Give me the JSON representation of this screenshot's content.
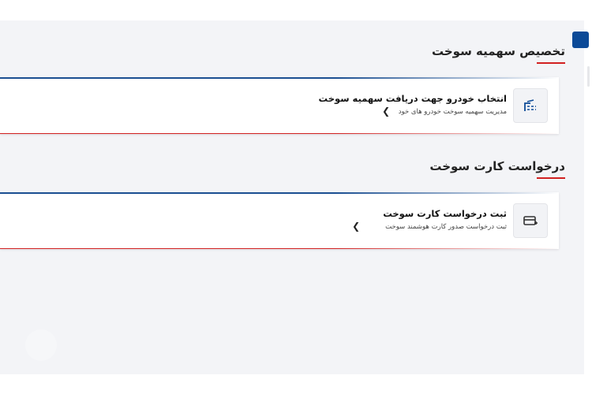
{
  "sections": [
    {
      "title": "تخصیص سهمیه سوخت",
      "card": {
        "title": "انتخاب خودرو جهت دریافت سهمیه سوخت",
        "subtitle": "مدیریت سهمیه سوخت خودرو های خود",
        "chevron": "❯",
        "icon": "fuel-pump-icon"
      }
    },
    {
      "title": "درخواست کارت سوخت",
      "card": {
        "title": "ثبت درخواست کارت سوخت",
        "subtitle": "ثبت درخواست صدور کارت هوشمند سوخت",
        "chevron": "❯",
        "icon": "add-card-icon"
      }
    }
  ],
  "colors": {
    "accent": "#0c4a97",
    "underline": "#d12020",
    "background": "#f3f4f7"
  }
}
